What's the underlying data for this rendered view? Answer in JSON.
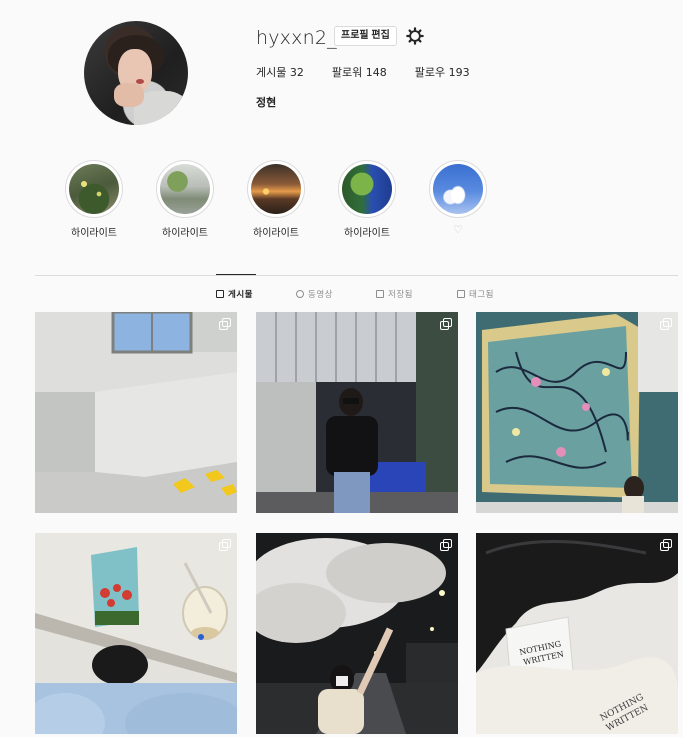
{
  "profile": {
    "username": "hyxxn2_",
    "edit_label": "프로필 편집",
    "settings_icon": "gear-icon",
    "stats": {
      "posts_label": "게시물",
      "posts_count": "32",
      "followers_label": "팔로워",
      "followers_count": "148",
      "following_label": "팔로우",
      "following_count": "193"
    },
    "full_name": "정현"
  },
  "highlights": [
    {
      "label": "하이라이트",
      "icon": "highlight-cover"
    },
    {
      "label": "하이라이트",
      "icon": "highlight-cover"
    },
    {
      "label": "하이라이트",
      "icon": "highlight-cover"
    },
    {
      "label": "하이라이트",
      "icon": "highlight-cover"
    },
    {
      "label": "",
      "icon": "heart-icon"
    }
  ],
  "tabs": [
    {
      "label": "게시물",
      "icon": "grid-icon",
      "active": true
    },
    {
      "label": "동영상",
      "icon": "video-icon",
      "active": false
    },
    {
      "label": "저장됨",
      "icon": "bookmark-icon",
      "active": false
    },
    {
      "label": "태그됨",
      "icon": "tag-icon",
      "active": false
    }
  ],
  "posts": [
    {
      "type": "multi",
      "icon": "carousel-icon"
    },
    {
      "type": "multi",
      "icon": "carousel-icon"
    },
    {
      "type": "multi",
      "icon": "carousel-icon"
    },
    {
      "type": "multi",
      "icon": "carousel-icon"
    },
    {
      "type": "multi",
      "icon": "carousel-icon"
    },
    {
      "type": "multi",
      "icon": "carousel-icon"
    }
  ],
  "colors": {
    "background": "#fafafa",
    "text": "#262626",
    "muted": "#8e8e8e",
    "border": "#dbdbdb"
  }
}
